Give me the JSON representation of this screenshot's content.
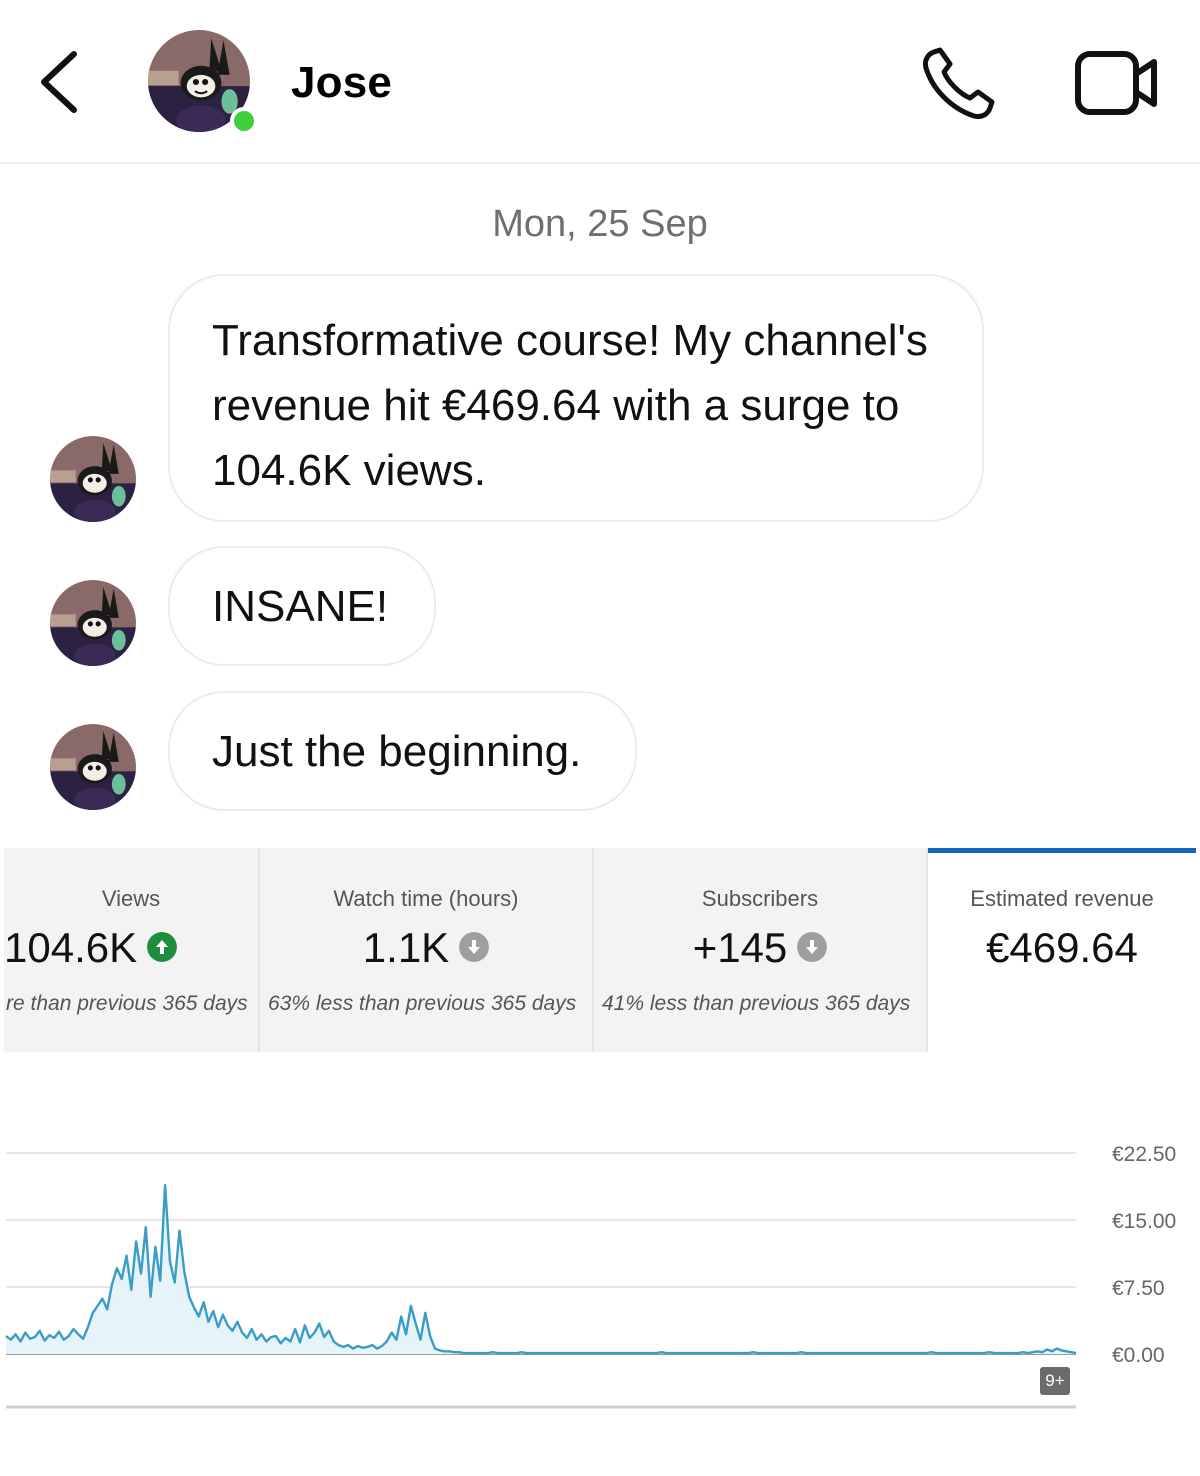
{
  "header": {
    "contact_name": "Jose",
    "online": true
  },
  "conversation": {
    "date_divider": "Mon, 25 Sep",
    "messages": [
      {
        "text": "Transformative course! My channel's revenue hit €469.64 with a surge to 104.6K views."
      },
      {
        "text": "INSANE!"
      },
      {
        "text": "Just the beginning."
      }
    ]
  },
  "analytics": {
    "cards": [
      {
        "label": "Views",
        "value": "104.6K",
        "comparison": "re than previous 365 days",
        "trend": "up",
        "trend_color": "#1e8e3e"
      },
      {
        "label": "Watch time (hours)",
        "value": "1.1K",
        "comparison": "63% less than previous 365 days",
        "trend": "down",
        "trend_color": "#9e9e9e"
      },
      {
        "label": "Subscribers",
        "value": "+145",
        "comparison": "41% less than previous 365 days",
        "trend": "down",
        "trend_color": "#9e9e9e"
      },
      {
        "label": "Estimated revenue",
        "value": "€469.64",
        "selected": true
      }
    ],
    "accent_color": "#1565c0",
    "more_badge": "9+"
  },
  "chart_data": {
    "type": "area",
    "ylabel": "",
    "y_ticks": [
      "€22.50",
      "€15.00",
      "€7.50",
      "€0.00"
    ],
    "ylim": [
      0,
      22.5
    ],
    "grid": true,
    "line_color": "#3a9cc7",
    "series": [
      {
        "values": [
          2.0,
          1.6,
          2.2,
          1.4,
          2.4,
          1.7,
          1.9,
          2.6,
          1.5,
          2.1,
          1.8,
          2.5,
          1.6,
          2.0,
          2.8,
          2.2,
          1.7,
          3.0,
          4.6,
          5.4,
          6.2,
          5.0,
          7.8,
          9.6,
          8.4,
          11.0,
          7.2,
          12.6,
          9.0,
          14.2,
          6.4,
          12.0,
          8.2,
          18.9,
          10.4,
          8.0,
          13.8,
          9.2,
          6.4,
          5.2,
          4.2,
          5.8,
          3.6,
          4.8,
          3.0,
          4.4,
          3.2,
          2.6,
          3.6,
          2.4,
          1.8,
          2.8,
          1.6,
          2.2,
          1.4,
          1.9,
          2.0,
          1.2,
          1.8,
          1.4,
          2.8,
          1.3,
          3.2,
          1.8,
          2.4,
          3.4,
          1.9,
          2.6,
          1.4,
          1.0,
          0.8,
          1.0,
          0.6,
          0.9,
          0.7,
          0.8,
          1.0,
          0.6,
          0.9,
          1.4,
          2.4,
          1.6,
          4.2,
          2.2,
          5.4,
          3.4,
          1.6,
          4.6,
          2.0,
          0.6,
          0.4,
          0.3,
          0.3,
          0.2,
          0.2,
          0.1,
          0.1,
          0.1,
          0.1,
          0.1,
          0.1,
          0.2,
          0.1,
          0.1,
          0.1,
          0.1,
          0.1,
          0.2,
          0.1,
          0.1,
          0.1,
          0.1,
          0.1,
          0.1,
          0.1,
          0.1,
          0.1,
          0.1,
          0.1,
          0.1,
          0.1,
          0.1,
          0.1,
          0.1,
          0.1,
          0.1,
          0.1,
          0.1,
          0.1,
          0.1,
          0.1,
          0.1,
          0.1,
          0.1,
          0.1,
          0.1,
          0.2,
          0.1,
          0.1,
          0.1,
          0.1,
          0.1,
          0.1,
          0.1,
          0.1,
          0.1,
          0.1,
          0.1,
          0.1,
          0.1,
          0.1,
          0.1,
          0.1,
          0.1,
          0.1,
          0.2,
          0.1,
          0.1,
          0.1,
          0.1,
          0.1,
          0.1,
          0.1,
          0.1,
          0.1,
          0.2,
          0.1,
          0.1,
          0.1,
          0.1,
          0.1,
          0.1,
          0.1,
          0.1,
          0.1,
          0.1,
          0.1,
          0.1,
          0.1,
          0.1,
          0.1,
          0.1,
          0.1,
          0.1,
          0.1,
          0.1,
          0.1,
          0.1,
          0.1,
          0.1,
          0.1,
          0.1,
          0.2,
          0.1,
          0.1,
          0.1,
          0.1,
          0.1,
          0.1,
          0.1,
          0.1,
          0.1,
          0.1,
          0.1,
          0.2,
          0.1,
          0.1,
          0.1,
          0.1,
          0.1,
          0.1,
          0.2,
          0.1,
          0.2,
          0.3,
          0.2,
          0.5,
          0.3,
          0.6,
          0.4,
          0.3,
          0.2,
          0.1
        ]
      }
    ]
  }
}
